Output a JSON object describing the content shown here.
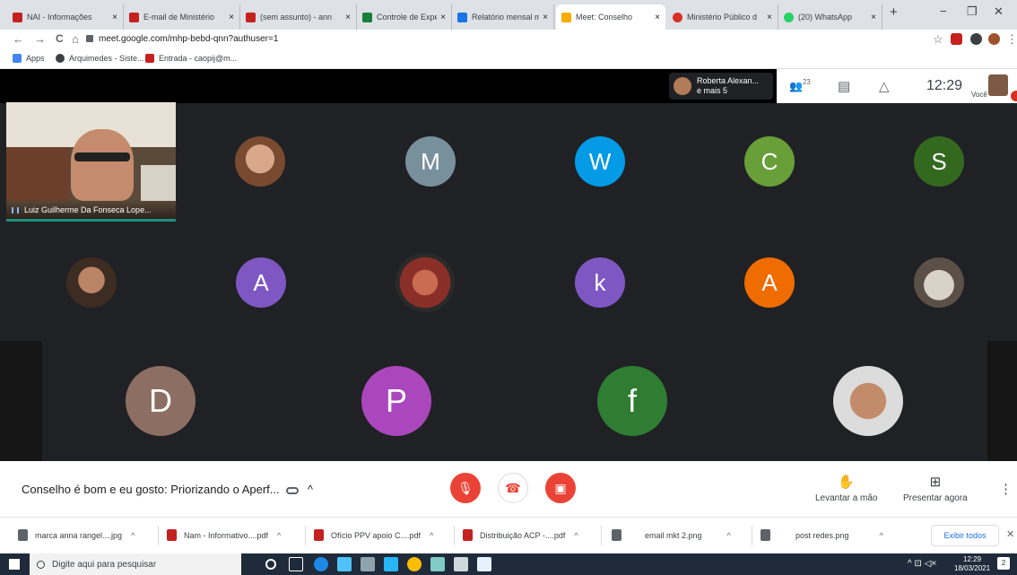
{
  "browser": {
    "tabs": [
      {
        "title": "NAI - Informações",
        "favicon_color": "#c5221f"
      },
      {
        "title": "E-mail de Ministério",
        "favicon_color": "#c5221f"
      },
      {
        "title": "(sem assunto) - ann",
        "favicon_color": "#c5221f"
      },
      {
        "title": "Controle de Expedi",
        "favicon_color": "#188038"
      },
      {
        "title": "Relatório mensal m",
        "favicon_color": "#1a73e8"
      },
      {
        "title": "Meet: Conselho",
        "favicon_color": "#f9ab00",
        "active": true
      },
      {
        "title": "Ministério Público d",
        "favicon_color": "#d93025"
      },
      {
        "title": "(20) WhatsApp",
        "favicon_color": "#25d366"
      }
    ],
    "new_tab": "+",
    "close_glyph": "×",
    "window_buttons": [
      "−",
      "❐",
      "✕"
    ],
    "url": "meet.google.com/mhp-bebd-qnn?authuser=1",
    "nav_glyphs": {
      "back": "←",
      "forward": "→",
      "reload": "C",
      "home": "⌂",
      "star": "☆",
      "menu": "⋮"
    },
    "bookmarks": [
      {
        "label": "Apps",
        "icon_color": "#4285f4"
      },
      {
        "label": "Arquimedes - Siste...",
        "icon_color": "#3c4043"
      },
      {
        "label": "Entrada - caopij@m...",
        "icon_color": "#c5221f"
      }
    ]
  },
  "meet": {
    "presenter": {
      "name": "Roberta Alexan...",
      "more": "e mais 5"
    },
    "participants_count": "23",
    "participants_glyph": "👥",
    "chat_glyph": "▤",
    "activities_glyph": "△",
    "clock": "12:29",
    "you_label": "Você",
    "featured_name": "Luiz Guilherme Da Fonseca Lope...",
    "tiles": [
      {
        "letter": "M",
        "color": "#78909c"
      },
      {
        "letter": "W",
        "color": "#039be5"
      },
      {
        "letter": "C",
        "color": "#689f38"
      },
      {
        "letter": "S",
        "color": "#33691e"
      },
      {
        "letter": "A",
        "color": "#7e57c2"
      },
      {
        "letter": "k",
        "color": "#7e57c2"
      },
      {
        "letter": "A",
        "color": "#ef6c00"
      },
      {
        "letter": "D",
        "color": "#8d6e63"
      },
      {
        "letter": "P",
        "color": "#ab47bc"
      },
      {
        "letter": "f",
        "color": "#2e7d32"
      }
    ],
    "meeting_title": "Conselho é bom e eu gosto: Priorizando o Aperf...",
    "meeting_title_chevron": "^",
    "controls": {
      "mic_glyph": "🎙",
      "hangup_glyph": "☎",
      "cam_glyph": "▣",
      "raise_hand": "Levantar a mão",
      "raise_hand_glyph": "✋",
      "present_now": "Presentar agora",
      "present_glyph": "⊞",
      "more_glyph": "⋮"
    }
  },
  "downloads": {
    "items": [
      {
        "name": "marca anna rangel....jpg",
        "icon_color": "#5f6368"
      },
      {
        "name": "Nam - Informativo....pdf",
        "icon_color": "#c5221f"
      },
      {
        "name": "Ofício PPV apoio C....pdf",
        "icon_color": "#c5221f"
      },
      {
        "name": "Distribuição ACP -....pdf",
        "icon_color": "#c5221f"
      },
      {
        "name": "email mkt 2.png",
        "icon_color": "#5f6368"
      },
      {
        "name": "post redes.png",
        "icon_color": "#5f6368"
      }
    ],
    "caret": "^",
    "show_all": "Exibir todos",
    "close": "✕"
  },
  "taskbar": {
    "search_placeholder": "Digite aqui para pesquisar",
    "time": "12:29",
    "date": "18/03/2021",
    "tray_glyphs": "^ ⊡ ◁×",
    "notifications": "2"
  }
}
